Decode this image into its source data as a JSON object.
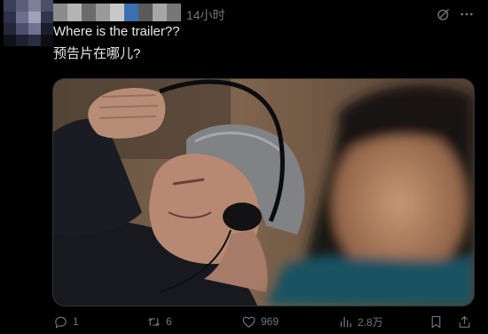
{
  "post": {
    "timestamp": "14小时",
    "text_line1": "Where is the trailer??",
    "text_line2": "预告片在哪儿?",
    "icons": {
      "grok": "grok-icon",
      "more": "more-icon"
    },
    "media": {
      "type": "photo"
    },
    "actions": {
      "replies": "1",
      "reposts": "6",
      "likes": "969",
      "views": "2.8万"
    }
  },
  "colors": {
    "background": "#000000",
    "text_primary": "#e7e9ea",
    "text_secondary": "#71767b",
    "border": "#2f3336"
  }
}
